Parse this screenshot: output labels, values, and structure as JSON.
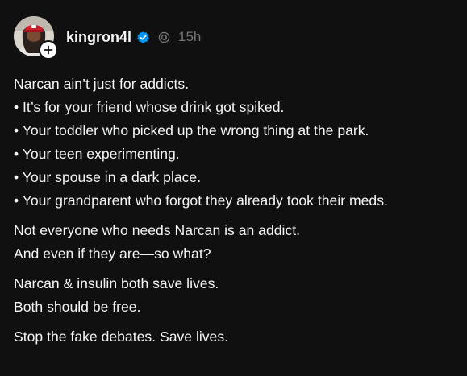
{
  "post": {
    "author": {
      "username": "kingron4l",
      "verified": true,
      "avatar_icon": "avatar-icon",
      "follow_icon": "plus-icon"
    },
    "timestamp": "15h",
    "paragraphs": [
      {
        "lines": [
          "Narcan ain’t just for addicts.",
          "• It’s for your friend whose drink got spiked.",
          "• Your toddler who picked up the wrong thing at the park.",
          "• Your teen experimenting.",
          "• Your spouse in a dark place.",
          "• Your grandparent who forgot they already took their meds."
        ]
      },
      {
        "lines": [
          "Not everyone who needs Narcan is an addict.",
          "And even if they are—so what?"
        ]
      },
      {
        "lines": [
          "Narcan & insulin both save lives.",
          "Both should be free."
        ]
      },
      {
        "lines": [
          "Stop the fake debates. Save lives."
        ]
      }
    ]
  },
  "colors": {
    "background": "#101010",
    "text": "#f3f5f7",
    "muted": "#777777",
    "verified_blue": "#0095f6"
  }
}
